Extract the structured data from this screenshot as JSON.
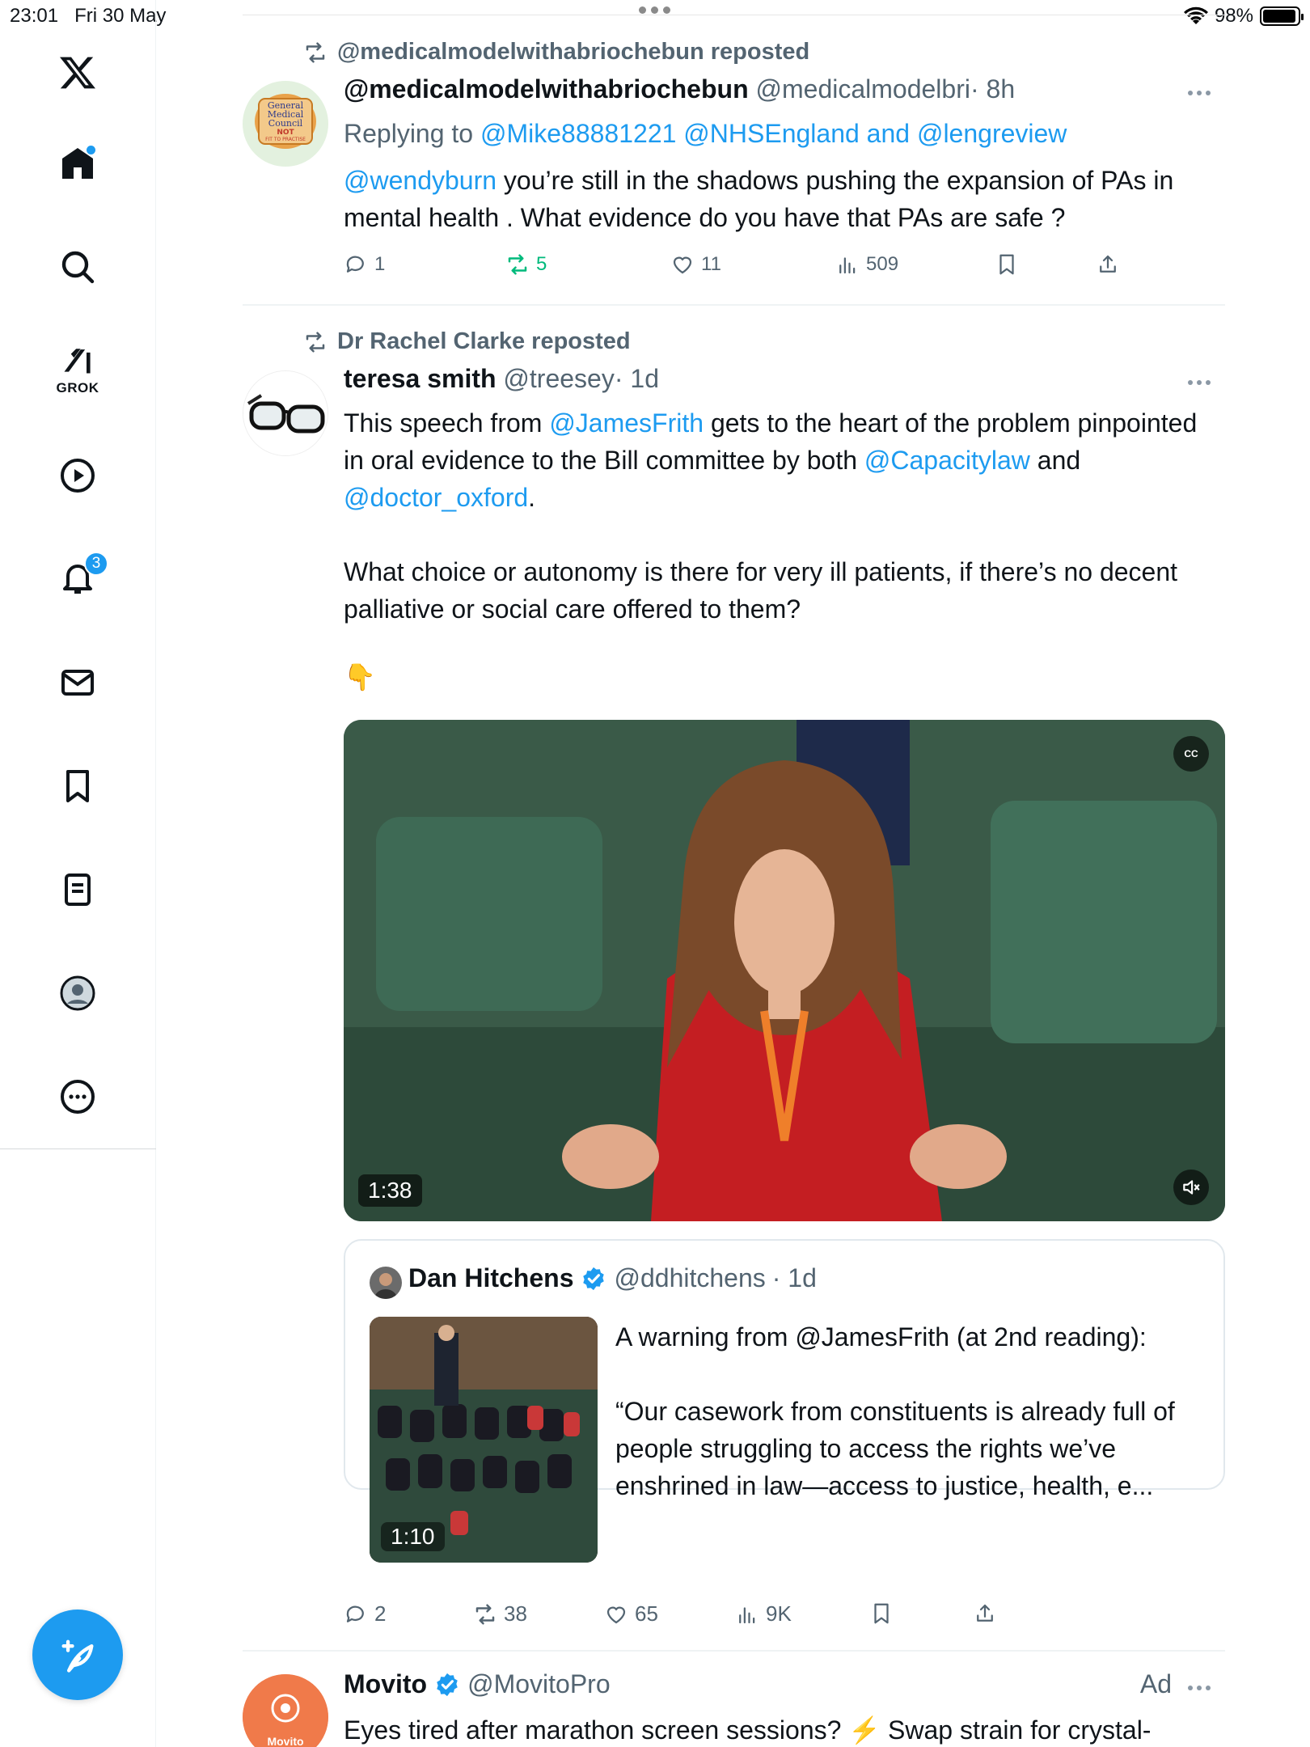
{
  "status_bar": {
    "time": "23:01",
    "date": "Fri 30 May",
    "battery": "98%",
    "battery_level": 0.98
  },
  "sidebar": {
    "items": [
      {
        "name": "home",
        "has_dot": true
      },
      {
        "name": "search"
      },
      {
        "name": "grok",
        "label": "GROK"
      },
      {
        "name": "video"
      },
      {
        "name": "notifications",
        "badge": "3"
      },
      {
        "name": "messages"
      },
      {
        "name": "bookmarks"
      },
      {
        "name": "lists"
      },
      {
        "name": "profile"
      },
      {
        "name": "more"
      }
    ],
    "accent": "#1d9bf0"
  },
  "posts": [
    {
      "repost_by": "@medicalmodelwithabriochebun reposted",
      "name": "@medicalmodelwithabriochebun",
      "handle": "@medicalmodelbri",
      "time": "· 8h",
      "reply_prefix": "Replying to",
      "reply_to": "@Mike88881221 @NHSEngland and @lengreview",
      "mention": "@wendyburn",
      "text_1": " you’re still in the shadows pushing the expansion of PAs in mental health . What  evidence do you have that PAs are safe ?",
      "avatar_text": [
        "General",
        "Medical",
        "Council",
        "NOT",
        "FIT TO PRACTISE"
      ],
      "stats": {
        "replies": "1",
        "reposts": "5",
        "likes": "11",
        "views": "509"
      }
    },
    {
      "repost_by": "Dr Rachel Clarke reposted",
      "name": "teresa smith",
      "handle": "@treesey",
      "time": "· 1d",
      "p1_a": "This speech from ",
      "p1_mention_1": "@JamesFrith",
      "p1_b": " gets to the heart of the problem pinpointed in oral evidence to the Bill committee by both ",
      "p1_mention_2": "@Capacitylaw",
      "p1_c": " and ",
      "p1_mention_3": "@doctor_oxford",
      "p1_d": ".",
      "p2": "What choice or autonomy is there for very ill patients, if there’s no decent palliative or social care offered to them?",
      "emoji": "👇",
      "video_time": "1:38",
      "cc_label": "CC",
      "quote": {
        "name": "Dan Hitchens",
        "handle": "@ddhitchens",
        "time": "· 1d",
        "thumb_time": "1:10",
        "text_1": "A warning from @JamesFrith (at 2nd reading):",
        "text_2": "“Our casework from constituents is already full of people struggling to access the rights we’ve enshrined in law—access to justice, health, e..."
      },
      "stats": {
        "replies": "2",
        "reposts": "38",
        "likes": "65",
        "views": "9K"
      }
    },
    {
      "name": "Movito",
      "handle": "@MovitoPro",
      "ad_label": "Ad",
      "avatar_text": "Movito",
      "text": "Eyes tired after marathon screen sessions? ⚡ Swap strain for crystal-"
    }
  ]
}
